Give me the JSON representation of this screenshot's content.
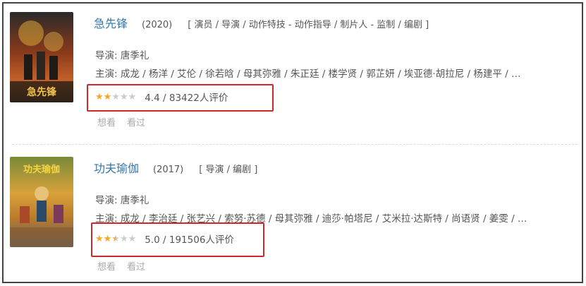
{
  "movies": [
    {
      "title": "急先锋",
      "year": "(2020)",
      "roles": "[ 演员 / 导演 / 动作特技 - 动作指导 / 制片人 - 监制 / 编剧 ]",
      "director_label": "导演:",
      "director": "唐季礼",
      "cast_label": "主演:",
      "cast": "成龙 / 杨洋 / 艾伦 / 徐若晗 / 母其弥雅 / 朱正廷 / 楼学贤 / 郭芷妍 / 埃亚德·胡拉尼 / 杨建平 / …",
      "star_rating": 2,
      "star_half": false,
      "rating_text": "4.4 / 83422人评价",
      "want_label": "想看",
      "seen_label": "看过",
      "poster_colors": [
        "#3a2c1e",
        "#c4602a",
        "#e8b23a"
      ],
      "poster_caption": "急先锋"
    },
    {
      "title": "功夫瑜伽",
      "year": "(2017)",
      "roles": "[ 导演 / 编剧 ]",
      "director_label": "导演:",
      "director": "唐季礼",
      "cast_label": "主演:",
      "cast": "成龙 / 李治廷 / 张艺兴 / 索努·苏德 / 母其弥雅 / 迪莎·帕塔尼 / 艾米拉·达斯特 / 尚语贤 / 姜雯 / …",
      "star_rating": 2,
      "star_half": true,
      "rating_text": "5.0 / 191506人评价",
      "want_label": "想看",
      "seen_label": "看过",
      "poster_colors": [
        "#7a8a3a",
        "#d8a23a",
        "#3f6b8f"
      ],
      "poster_caption": "功夫瑜伽"
    }
  ],
  "colors": {
    "link": "#3377aa",
    "star_on": "#f5a623",
    "star_off": "#cccccc",
    "highlight": "#cc2a2a"
  }
}
